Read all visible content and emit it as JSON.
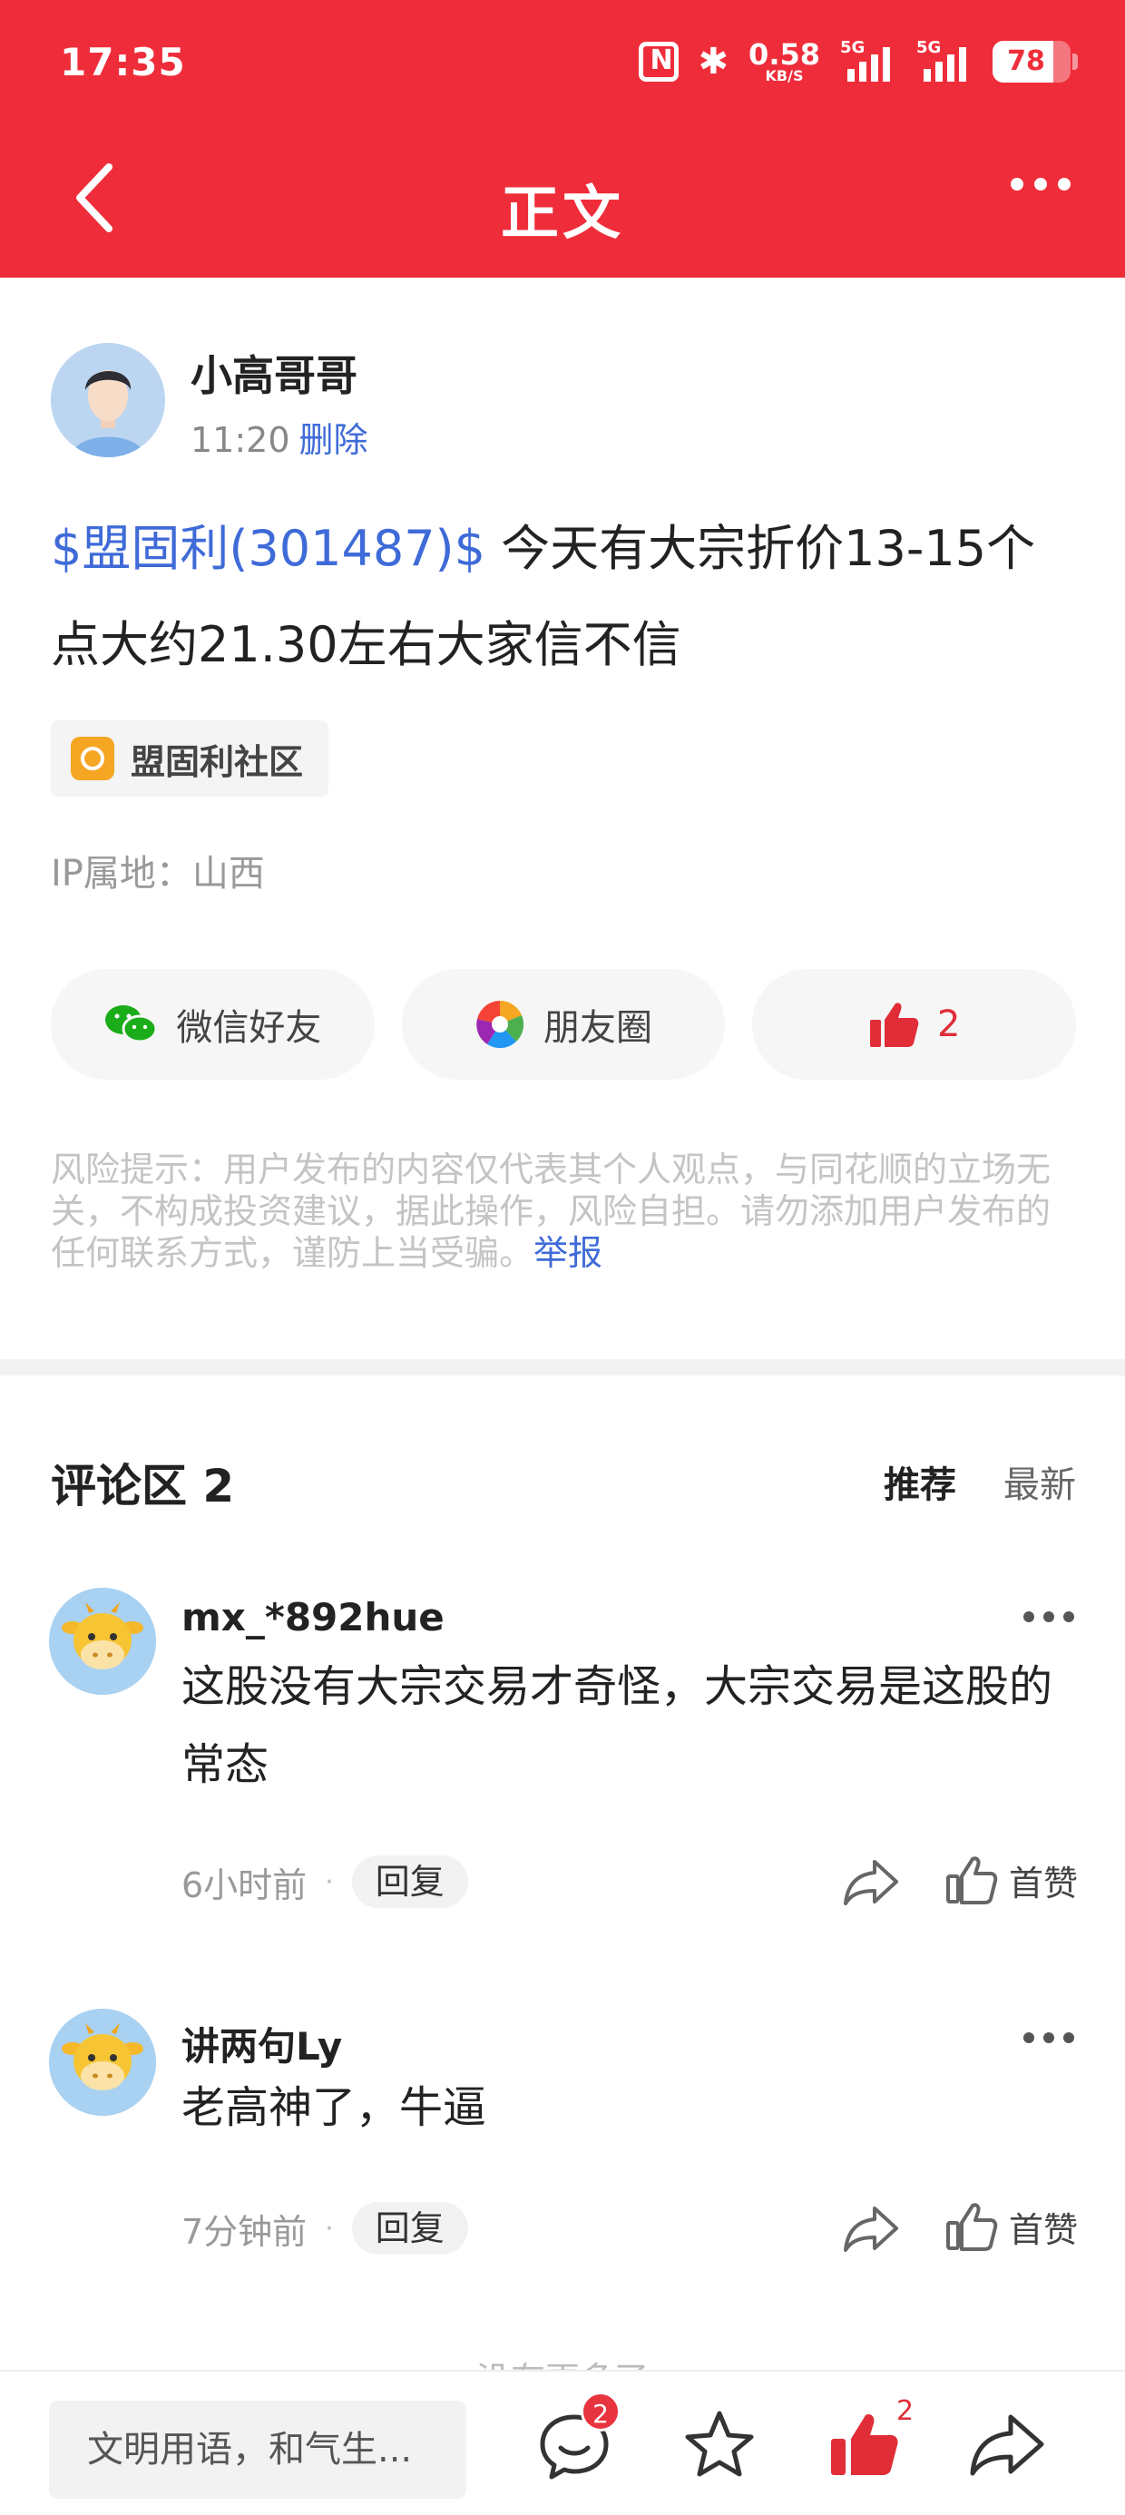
{
  "status_bar": {
    "time": "17:35",
    "net_speed": "0.58",
    "net_unit": "KB/S",
    "sim1": "5G",
    "sim2": "5G",
    "battery": "78",
    "battery_level": 0.78,
    "icons": [
      "nfc-icon",
      "bluetooth-icon",
      "signal-icon",
      "signal-icon",
      "battery-icon"
    ]
  },
  "header": {
    "title": "正文",
    "back_icon": "chevron-left-icon",
    "more_icon": "more-horizontal-icon",
    "bg_color": "#ef2d3a"
  },
  "post": {
    "author": "小高哥哥",
    "time": "11:20",
    "delete_label": "删除",
    "stock_tag": "$盟固利(301487)$",
    "body": " 今天有大宗折价13-15个点大约21.30左右大家信不信",
    "community": "盟固利社区",
    "ip_location": "IP属地：山西"
  },
  "share": {
    "wechat": "微信好友",
    "moments": "朋友圈",
    "like_count": "2"
  },
  "risk": {
    "text": "风险提示：用户发布的内容仅代表其个人观点，与同花顺的立场无关，不构成投资建议，据此操作，风险自担。请勿添加用户发布的任何联系方式，谨防上当受骗。",
    "report_label": "举报"
  },
  "comments_section": {
    "title": "评论区 2",
    "sort_recommended": "推荐",
    "sort_latest": "最新",
    "items": [
      {
        "user": "mx_*892hue",
        "text": "这股没有大宗交易才奇怪，大宗交易是这股的常态",
        "time": "6小时前",
        "dot": "·",
        "reply_label": "回复",
        "like_label": "首赞"
      },
      {
        "user": "讲两句Ly",
        "text": "老高神了，牛逼",
        "time": "7分钟前",
        "dot": "·",
        "reply_label": "回复",
        "like_label": "首赞"
      }
    ],
    "end_note": "没有更多了"
  },
  "bottom_bar": {
    "input_placeholder": "文明用语，和气生...",
    "comment_badge": "2",
    "like_count": "2"
  }
}
